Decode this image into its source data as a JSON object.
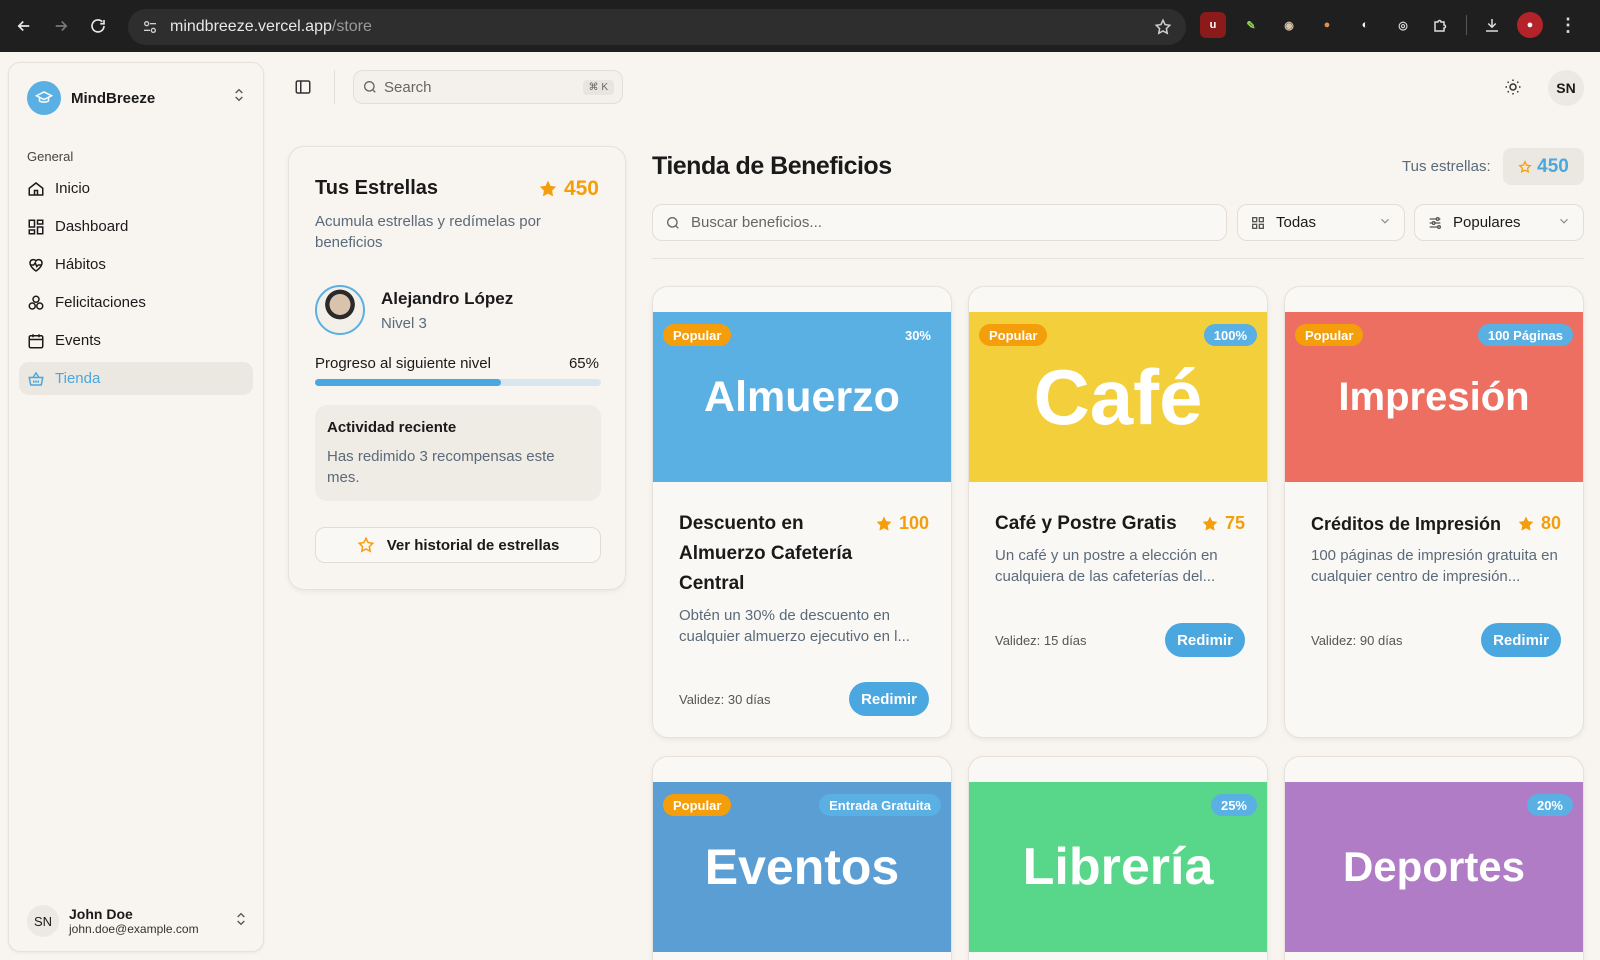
{
  "browser": {
    "url_host": "mindbreeze.vercel.app",
    "url_path": "/store"
  },
  "sidebar": {
    "brand": "MindBreeze",
    "section": "General",
    "items": [
      {
        "label": "Inicio",
        "icon": "home-icon",
        "active": false
      },
      {
        "label": "Dashboard",
        "icon": "dashboard-icon",
        "active": false
      },
      {
        "label": "Hábitos",
        "icon": "heart-pulse-icon",
        "active": false
      },
      {
        "label": "Felicitaciones",
        "icon": "award-icon",
        "active": false
      },
      {
        "label": "Events",
        "icon": "calendar-icon",
        "active": false
      },
      {
        "label": "Tienda",
        "icon": "basket-icon",
        "active": true
      }
    ],
    "user": {
      "initials": "SN",
      "name": "John Doe",
      "email": "john.doe@example.com"
    }
  },
  "topbar": {
    "search_placeholder": "Search",
    "shortcut": "⌘ K",
    "avatar_initials": "SN"
  },
  "stars_card": {
    "title": "Tus Estrellas",
    "total": "450",
    "description": "Acumula estrellas y redímelas por beneficios",
    "user_name": "Alejandro López",
    "user_level": "Nivel 3",
    "progress_label": "Progreso al siguiente nivel",
    "progress_text": "65%",
    "progress_value": 0.65,
    "activity_title": "Actividad reciente",
    "activity_text": "Has redimido 3 recompensas este mes.",
    "history_button": "Ver historial de estrellas"
  },
  "store": {
    "title": "Tienda de Beneficios",
    "my_stars_label": "Tus estrellas:",
    "my_stars_value": "450",
    "search_placeholder": "Buscar beneficios...",
    "category_select": "Todas",
    "sort_select": "Populares"
  },
  "cards": [
    {
      "image_text": "Almuerzo",
      "color": "#5aafe3",
      "badge_left": "Popular",
      "badge_right": "30%",
      "title": "Descuento en Almuerzo Cafetería Central",
      "cost": "100",
      "description": "Obtén un 30% de descuento en cualquier almuerzo ejecutivo en l...",
      "validity": "Validez: 30 días",
      "button": "Redimir"
    },
    {
      "image_text": "Café",
      "color": "#f4cf3c",
      "badge_left": "Popular",
      "badge_right": "100%",
      "title": "Café y Postre Gratis",
      "cost": "75",
      "description": "Un café y un postre a elección en cualquiera de las cafeterías del...",
      "validity": "Validez: 15 días",
      "button": "Redimir"
    },
    {
      "image_text": "Impresión",
      "color": "#ec6f62",
      "badge_left": "Popular",
      "badge_right": "100 Páginas",
      "title": "Créditos de Impresión",
      "cost": "80",
      "description": "100 páginas de impresión gratuita en cualquier centro de impresión...",
      "validity": "Validez: 90 días",
      "button": "Redimir"
    },
    {
      "image_text": "Eventos",
      "color": "#5a9ed4",
      "badge_left": "Popular",
      "badge_right": "Entrada Gratuita"
    },
    {
      "image_text": "Librería",
      "color": "#58d68a",
      "badge_right": "25%"
    },
    {
      "image_text": "Deportes",
      "color": "#b07cc6",
      "badge_right": "20%"
    }
  ]
}
